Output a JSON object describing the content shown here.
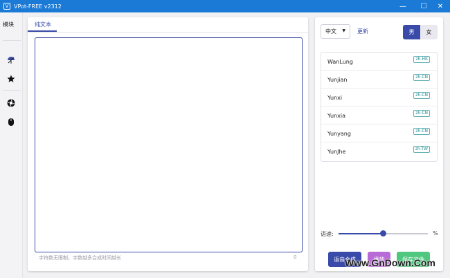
{
  "titlebar": {
    "title": "VPot-FREE v2312",
    "app_icon": "V",
    "minimize": "—",
    "maximize": "☐",
    "close": "✕"
  },
  "sidebar": {
    "label": "模块",
    "icons": [
      "umbrella-icon",
      "star-icon",
      "aperture-icon",
      "mouse-icon"
    ]
  },
  "editor": {
    "tab_label": "纯文本",
    "text": "",
    "hint": "字符数无限制，字数越多合成时间越长",
    "count": "0"
  },
  "voice_panel": {
    "language": "中文",
    "refresh_label": "更新",
    "gender_male": "男",
    "gender_female": "女",
    "selected_gender": "male",
    "voices": [
      {
        "name": "WanLung",
        "locale": "zh-HK"
      },
      {
        "name": "Yunjian",
        "locale": "zh-CN"
      },
      {
        "name": "Yunxi",
        "locale": "zh-CN"
      },
      {
        "name": "Yunxia",
        "locale": "zh-CN"
      },
      {
        "name": "Yunyang",
        "locale": "zh-CN"
      },
      {
        "name": "YunJhe",
        "locale": "zh-TW"
      }
    ],
    "speed_label": "语速:",
    "speed_value": 0.5,
    "speed_unit": "%"
  },
  "actions": {
    "synthesize": "语音合成",
    "play": "播放",
    "save": "保存文件"
  },
  "watermark": "Www.GnDown.Com",
  "colors": {
    "titlebar": "#1a7ad6",
    "accent": "#3a4aa8",
    "play": "#b86ad6",
    "save": "#4fc77e",
    "badge": "#1f8a8f"
  }
}
